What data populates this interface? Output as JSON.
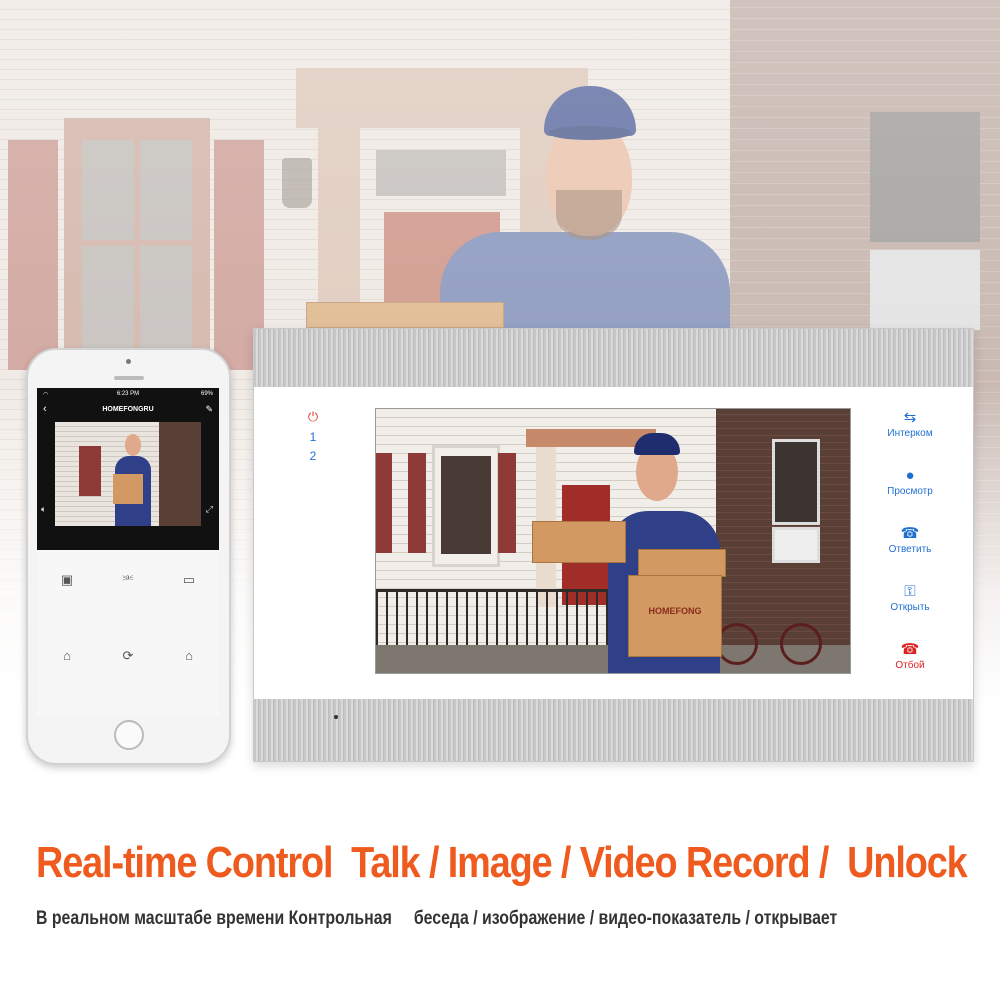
{
  "phone": {
    "status_time": "6:23 PM",
    "status_battery": "69%",
    "app_title": "HOMEFONGRU",
    "back_icon": "back-chevron-icon",
    "edit_icon": "edit-pencil-icon",
    "controls": [
      "camera-icon",
      "microphone-icon",
      "video-record-icon",
      "lock-icon",
      "switch-icon",
      "lock-icon"
    ]
  },
  "monitor": {
    "line_labels": [
      "1",
      "2"
    ],
    "power_icon": "power-icon",
    "buttons": [
      {
        "label": "Интерком",
        "icon": "intercom-arrows-icon",
        "color": "#1f6fd1"
      },
      {
        "label": "Просмотр",
        "icon": "person-icon",
        "color": "#1f6fd1"
      },
      {
        "label": "Ответить",
        "icon": "phone-answer-icon",
        "color": "#1f6fd1"
      },
      {
        "label": "Открыть",
        "icon": "key-icon",
        "color": "#1f6fd1"
      },
      {
        "label": "Отбой",
        "icon": "phone-hangup-icon",
        "color": "#dd2222"
      }
    ]
  },
  "box_brand": "HOMEFONG",
  "headline": "Real-time Control  Talk / Image / Video Record /  Unlock",
  "subline": "В реальном масштабе времени Контрольная     беседа / изображение / видео-показатель / открывает",
  "colors": {
    "headline": "#ef5a1e",
    "accent_blue": "#1f6fd1",
    "hangup_red": "#dd2222"
  }
}
